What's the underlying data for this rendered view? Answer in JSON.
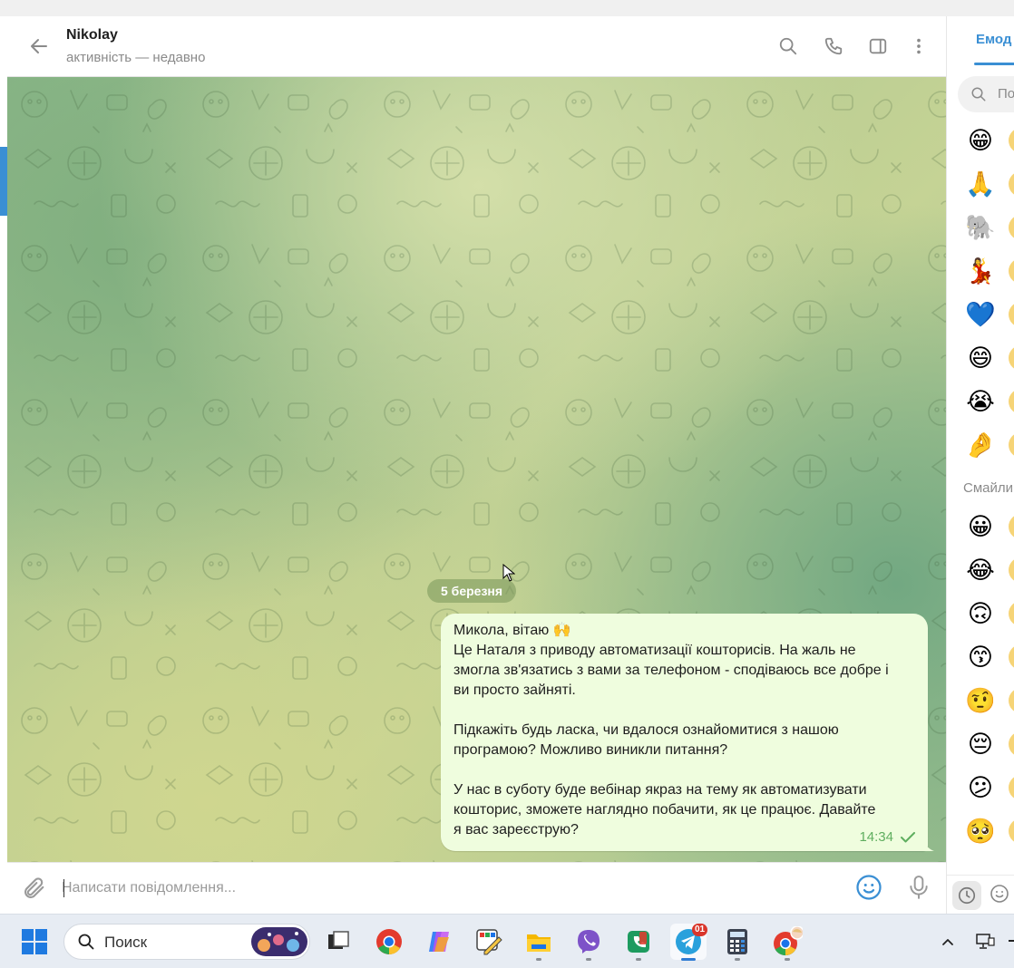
{
  "header": {
    "peer_name": "Nikolay",
    "peer_status": "активність — недавно"
  },
  "chat": {
    "date_badge": "5 березня",
    "message": {
      "lines": [
        "Микола, вітаю 🙌",
        "Це Наталя з приводу автоматизації кошторисів. На жаль не",
        "змогла зв'язатись з вами за телефоном - сподіваюсь все добре і",
        "ви просто зайняті.",
        "",
        "Підкажіть будь ласка, чи вдалося ознайомитися з нашою",
        "програмою?  Можливо виникли питання?",
        "",
        "У нас в суботу буде вебінар якраз на тему як автоматизувати",
        "кошторис, зможете наглядно побачити, як це працює.  Давайте",
        "я вас зареєструю?"
      ],
      "time": "14:34",
      "status": "sent-check-icon"
    }
  },
  "composer": {
    "placeholder": "Написати повідомлення..."
  },
  "emoji_panel": {
    "tab_label": "Емод",
    "search_placeholder": "По",
    "section_label": "Смайли",
    "recent_emojis": [
      "😁",
      "🙏",
      "🐘",
      "💃",
      "💙",
      "😄",
      "😭",
      "🤌"
    ],
    "smileys": [
      "😀",
      "😂",
      "🙃",
      "😙",
      "🤨",
      "😔",
      "😕",
      "🥺"
    ]
  },
  "taskbar": {
    "search_label": "Поиск",
    "telegram_badge": "01",
    "apps": [
      "windows-start-icon",
      "search-icon",
      "task-view-icon",
      "chrome-icon",
      "copilot-icon",
      "paint-icon",
      "file-explorer-icon",
      "viber-icon",
      "phone-link-icon",
      "telegram-icon",
      "calculator-icon",
      "chrome-profile-icon"
    ]
  },
  "colors": {
    "accent": "#3a8fd4",
    "bubble": "#effdde",
    "time_green": "#5fae5f"
  }
}
